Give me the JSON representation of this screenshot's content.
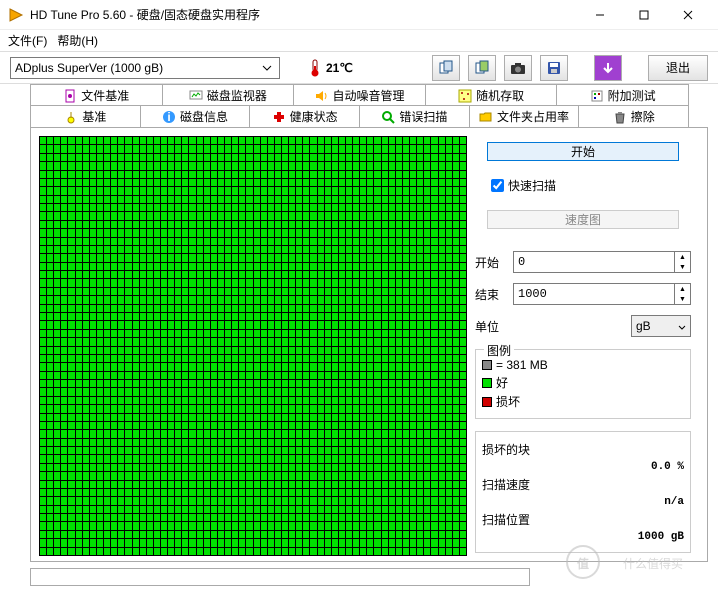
{
  "window": {
    "title": "HD Tune Pro 5.60 - 硬盘/固态硬盘实用程序"
  },
  "menu": {
    "file": "文件(F)",
    "help": "帮助(H)"
  },
  "toolbar": {
    "drive": "ADplus SuperVer (1000 gB)",
    "temperature": "21℃",
    "exit": "退出"
  },
  "tabs_row1": [
    {
      "label": "文件基准"
    },
    {
      "label": "磁盘监视器"
    },
    {
      "label": "自动噪音管理"
    },
    {
      "label": "随机存取"
    },
    {
      "label": "附加测试"
    }
  ],
  "tabs_row2": [
    {
      "label": "基准"
    },
    {
      "label": "磁盘信息"
    },
    {
      "label": "健康状态"
    },
    {
      "label": "错误扫描",
      "active": true
    },
    {
      "label": "文件夹占用率"
    },
    {
      "label": "擦除"
    }
  ],
  "panel": {
    "start_btn": "开始",
    "quick_scan": "快速扫描",
    "speedmap_btn": "速度图",
    "start_label": "开始",
    "start_val": "0",
    "end_label": "结束",
    "end_val": "1000",
    "unit_label": "单位",
    "unit_val": "gB"
  },
  "legend": {
    "caption": "图例",
    "block_size": "= 381 MB",
    "ok": "好",
    "bad": "损坏"
  },
  "stats": {
    "damaged_label": "损坏的块",
    "damaged_val": "0.0 %",
    "speed_label": "扫描速度",
    "speed_val": "n/a",
    "pos_label": "扫描位置",
    "pos_val": "1000 gB"
  },
  "watermark": "值 · 什么值得买"
}
